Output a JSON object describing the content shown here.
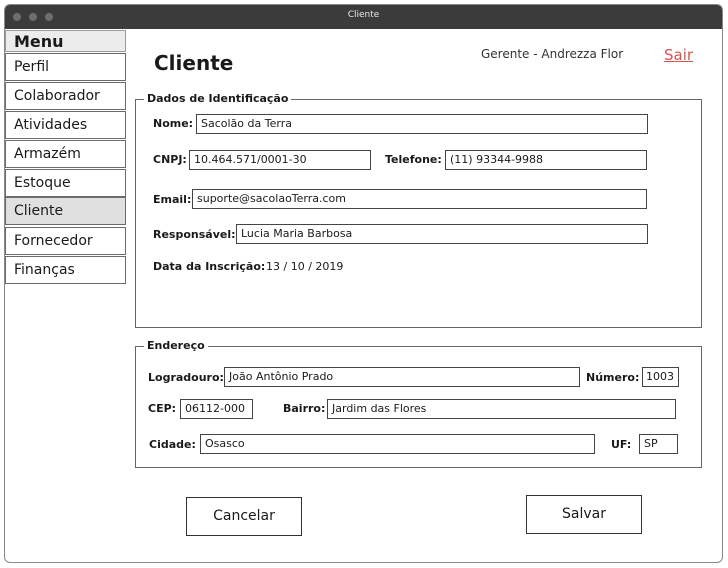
{
  "window": {
    "title": "Cliente"
  },
  "menu": {
    "heading": "Menu",
    "items": [
      {
        "label": "Perfil"
      },
      {
        "label": "Colaborador"
      },
      {
        "label": "Atividades"
      },
      {
        "label": "Armazém"
      },
      {
        "label": "Estoque"
      },
      {
        "label": "Cliente",
        "active": true
      },
      {
        "label": "Fornecedor"
      },
      {
        "label": "Finanças"
      }
    ]
  },
  "header": {
    "title": "Cliente",
    "user": "Gerente - Andrezza Flor",
    "logout_label": "Sair",
    "logout_color": "#d9534f"
  },
  "identificacao": {
    "legend": "Dados de Identificação",
    "nome_label": "Nome:",
    "nome_value": "Sacolão da Terra",
    "cnpj_label": "CNPJ:",
    "cnpj_value": "10.464.571/0001-30",
    "telefone_label": "Telefone:",
    "telefone_value": "(11) 93344-9988",
    "email_label": "Email:",
    "email_value": "suporte@sacolaoTerra.com",
    "responsavel_label": "Responsável:",
    "responsavel_value": "Lucia Maria Barbosa",
    "inscricao_label": "Data da Inscrição:",
    "inscricao_value": "13 / 10 / 2019"
  },
  "endereco": {
    "legend": "Endereço",
    "logradouro_label": "Logradouro:",
    "logradouro_value": "João Antônio Prado",
    "numero_label": "Número:",
    "numero_value": "1003",
    "cep_label": "CEP:",
    "cep_value": "06112-000",
    "bairro_label": "Bairro:",
    "bairro_value": "Jardim das Flores",
    "cidade_label": "Cidade:",
    "cidade_value": "Osasco",
    "uf_label": "UF:",
    "uf_value": "SP"
  },
  "actions": {
    "cancel_label": "Cancelar",
    "save_label": "Salvar"
  }
}
